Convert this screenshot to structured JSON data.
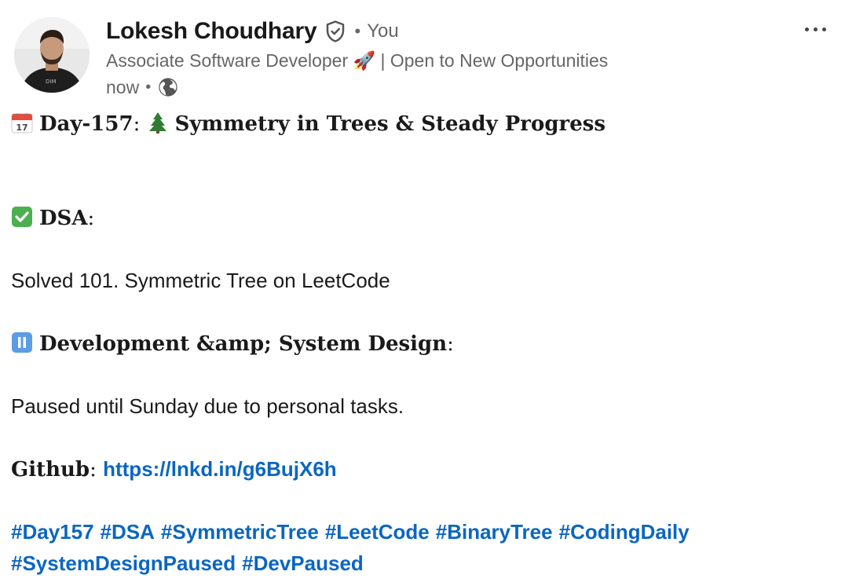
{
  "author": {
    "name": "Lokesh Choudhary",
    "relation": "You",
    "headline": "Associate Software Developer 🚀 | Open to New Opportunities",
    "time": "now"
  },
  "post": {
    "title_prefix": "Day-157",
    "title_suffix": "Symmetry in Trees & Steady Progress",
    "dsa_heading": "DSA",
    "dsa_text": "Solved 101. Symmetric Tree on LeetCode",
    "dev_heading": "Development &amp; System Design",
    "dev_text": "Paused until Sunday due to personal tasks.",
    "github_label": "Github",
    "github_link": "https://lnkd.in/g6BujX6h",
    "hashtags_line1": [
      "#Day157",
      "#DSA",
      "#SymmetricTree",
      "#LeetCode",
      "#BinaryTree",
      "#CodingDaily"
    ],
    "hashtags_line2": [
      "#SystemDesignPaused",
      "#DevPaused"
    ]
  },
  "icons": {
    "verified": "verified-shield-icon",
    "globe": "globe-icon",
    "calendar": "calendar-emoji-icon",
    "tree": "tree-emoji-icon",
    "check": "check-emoji-icon",
    "pause": "pause-emoji-icon",
    "more": "more-options-icon"
  },
  "colors": {
    "link": "#0a66c2",
    "secondary_text": "#666666",
    "primary_text": "#1a1a1a"
  }
}
